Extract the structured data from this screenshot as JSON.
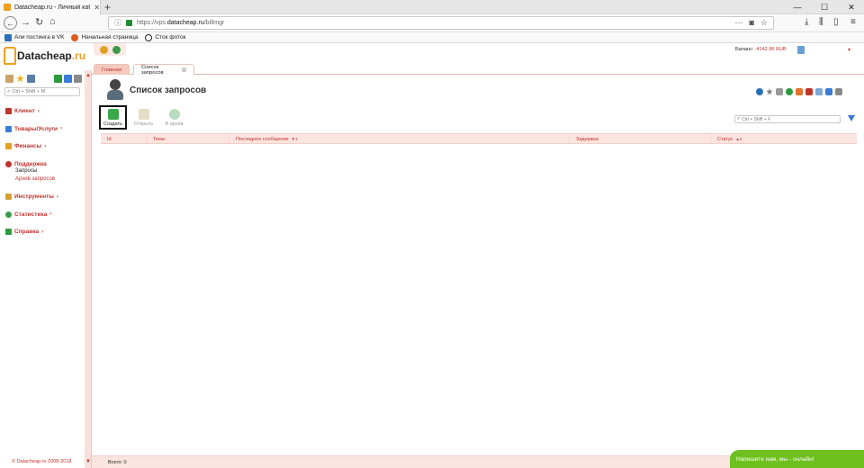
{
  "browser": {
    "tab_title": "Datacheap.ru - Личный кабин",
    "url_scheme": "https://vps.",
    "url_host": "datacheap.ru",
    "url_path": "/billmgr",
    "bookmarks": [
      {
        "label": "Апи постинга в VK",
        "color": "#2d6fb9"
      },
      {
        "label": "Начальная страница",
        "color": "#e05a1e"
      },
      {
        "label": "Сток фоток",
        "color": "#222222"
      }
    ]
  },
  "brand": {
    "logo_text": "Datacheap",
    "logo_suffix": ".ru",
    "accent": "#c0322b",
    "logo_color": "#e8a020"
  },
  "sidebar": {
    "search_placeholder": "Ctrl + Shift + M",
    "menu": [
      {
        "label": "Клиент",
        "icon": "client-icon",
        "color": "#c0322b"
      },
      {
        "label": "Товары/Услуги",
        "icon": "cart-icon",
        "color": "#3a7bd5"
      },
      {
        "label": "Финансы",
        "icon": "finance-icon",
        "color": "#e0a020"
      },
      {
        "label": "Поддержка",
        "icon": "support-icon",
        "color": "#c0322b"
      },
      {
        "label": "Инструменты",
        "icon": "tools-icon",
        "color": "#d6a030"
      },
      {
        "label": "Статистика",
        "icon": "stats-icon",
        "color": "#3a9a4a"
      },
      {
        "label": "Справка",
        "icon": "help-icon",
        "color": "#2e9a3e"
      }
    ],
    "support_sub": [
      {
        "label": "Запросы"
      },
      {
        "label": "Архив запросов"
      }
    ],
    "copyright": "© Datacheap.ru 2008-2018"
  },
  "header": {
    "balance_label": "Баланс: ",
    "balance_value": "-4142.96 RUB"
  },
  "tabs": {
    "main": "Главная",
    "active": "Список запросов"
  },
  "page": {
    "title": "Список запросов"
  },
  "toolbar": {
    "create": "Создать",
    "open": "Открыть",
    "archive": "В архив",
    "search_placeholder": "Ctrl + Shift + F"
  },
  "table": {
    "columns": [
      "Id",
      "Тема",
      "Последнее сообщение",
      "Задержка",
      "Статус"
    ],
    "total": "Всего: 0"
  },
  "chat": {
    "label": "Напишите нам, мы - онлайн!"
  }
}
